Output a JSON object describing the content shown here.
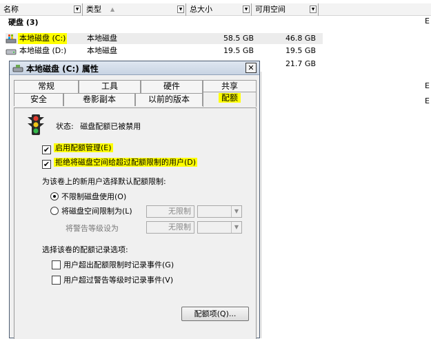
{
  "explorer": {
    "columns": [
      {
        "label": "名称"
      },
      {
        "label": "类型"
      },
      {
        "label": "总大小"
      },
      {
        "label": "可用空间"
      }
    ],
    "sort_arrow": "▲",
    "group_label": "硬盘 (3)",
    "side_letter": "E",
    "drives": [
      {
        "name": "本地磁盘 (C:)",
        "type": "本地磁盘",
        "total": "58.5 GB",
        "free": "46.8 GB"
      },
      {
        "name": "本地磁盘 (D:)",
        "type": "本地磁盘",
        "total": "19.5 GB",
        "free": "19.5 GB"
      },
      {
        "name": "",
        "type": "",
        "total": "",
        "free": "21.7 GB"
      }
    ]
  },
  "dialog": {
    "title": "本地磁盘 (C:) 属性",
    "close_label": "✕",
    "tabs_row1": [
      "常规",
      "工具",
      "硬件",
      "共享"
    ],
    "tabs_row2": [
      "安全",
      "卷影副本",
      "以前的版本",
      "配额"
    ],
    "active_tab": "配额",
    "status_label": "状态:",
    "status_value": "磁盘配额已被禁用",
    "enable_quota_label": "启用配额管理(E)",
    "enable_quota_checked": true,
    "deny_space_label": "拒绝将磁盘空间给超过配额限制的用户(D)",
    "deny_space_checked": true,
    "default_limit_heading": "为该卷上的新用户选择默认配额限制:",
    "no_limit_label": "不限制磁盘使用(O)",
    "limit_label": "将磁盘空间限制为(L)",
    "limit_value": "无限制",
    "warning_label": "将警告等级设为",
    "warning_value": "无限制",
    "selected_radio": "no_limit",
    "logging_heading": "选择该卷的配额记录选项:",
    "log_exceed_limit_label": "用户超出配额限制时记录事件(G)",
    "log_exceed_warning_label": "用户超过警告等级时记录事件(V)",
    "quota_entries_button": "配额项(Q)...",
    "check_mark": "✔"
  },
  "colors": {
    "highlight": "#ffff00",
    "dialog_bg": "#f0f0f0",
    "titlebar_top": "#dfe7f1",
    "titlebar_bottom": "#c8d4e3"
  }
}
